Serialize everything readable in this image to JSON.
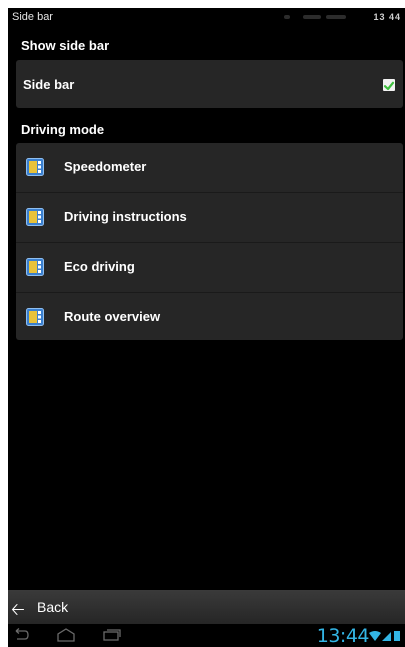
{
  "status_bar": {
    "title": "Side bar",
    "time": "13 44"
  },
  "show_side_bar_section": {
    "header": "Show side bar",
    "row_label": "Side bar",
    "checked": true
  },
  "driving_mode_section": {
    "header": "Driving mode",
    "items": [
      {
        "label": "Speedometer",
        "icon": "widget-icon"
      },
      {
        "label": "Driving instructions",
        "icon": "widget-icon"
      },
      {
        "label": "Eco driving",
        "icon": "widget-icon"
      },
      {
        "label": "Route overview",
        "icon": "widget-icon"
      }
    ]
  },
  "back_bar": {
    "arrow_icon": "back-arrow-icon",
    "label": "Back"
  },
  "nav_bar": {
    "buttons": [
      "nav-back-icon",
      "nav-home-icon",
      "nav-recents-icon"
    ],
    "clock": "13:44",
    "system_icons": [
      "wifi-icon",
      "signal-icon",
      "battery-icon"
    ]
  },
  "colors": {
    "background": "#000000",
    "card": "#262626",
    "checkbox_check": "#3fbf3f",
    "clock": "#33b5e5",
    "icon_blue": "#3a7fcf",
    "icon_yellow": "#e8c23a"
  }
}
